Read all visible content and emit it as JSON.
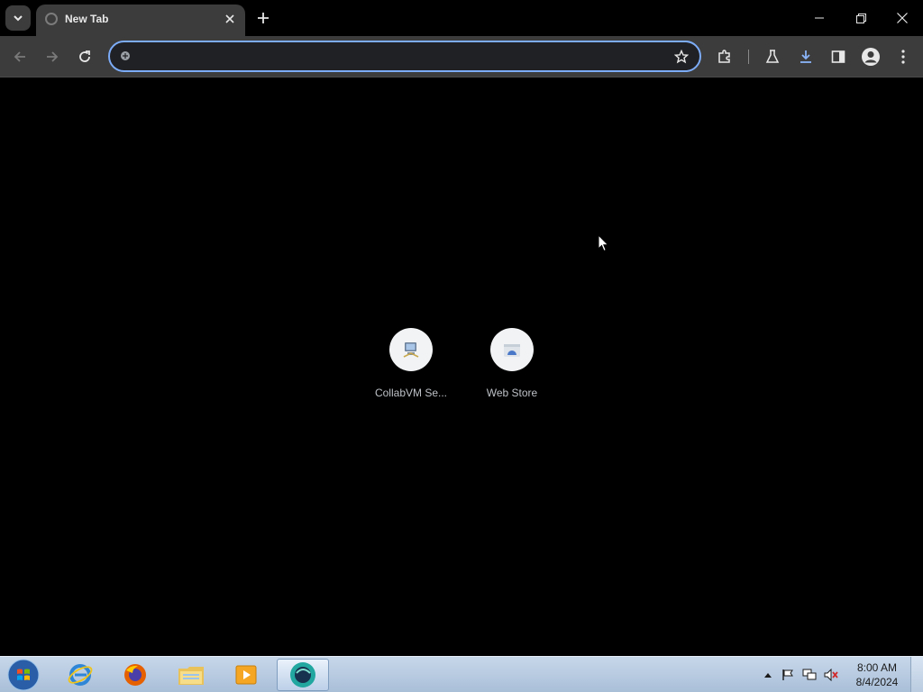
{
  "browser": {
    "tab": {
      "title": "New Tab"
    },
    "omnibox": {
      "value": "",
      "placeholder": ""
    }
  },
  "shortcuts": [
    {
      "label": "CollabVM Se..."
    },
    {
      "label": "Web Store"
    }
  ],
  "taskbar": {
    "clock": {
      "time": "8:00 AM",
      "date": "8/4/2024"
    }
  },
  "colors": {
    "tab_bg": "#3c3c3c",
    "omnibox_border": "#7cacf8",
    "accent_blue": "#8ab4f8"
  }
}
